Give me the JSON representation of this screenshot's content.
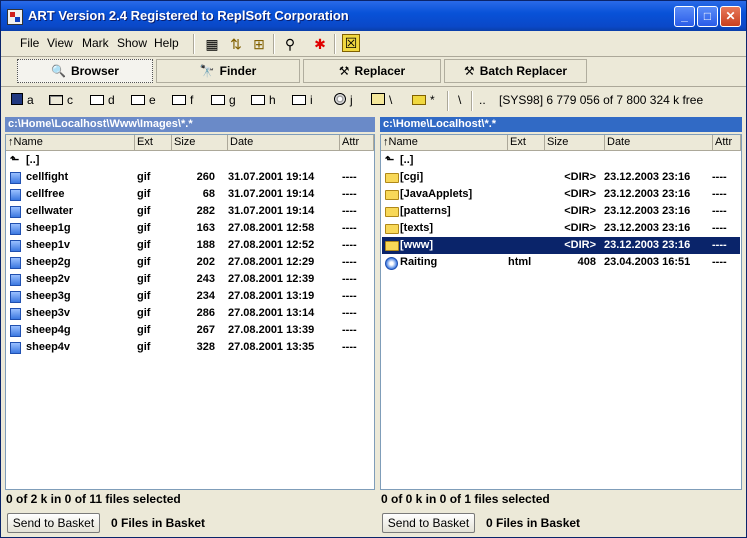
{
  "window": {
    "title": "ART Version 2.4 Registered to ReplSoft Corporation",
    "controls": {
      "minimize": "_",
      "maximize": "□",
      "close": "✕"
    }
  },
  "menu": [
    "File",
    "View",
    "Mark",
    "Show",
    "Help"
  ],
  "toolbar_icons": [
    "grid-icon",
    "sort-icon",
    "tree-icon",
    "search-tool-icon",
    "star-icon",
    "exit-icon"
  ],
  "modes": [
    {
      "label": "Browser",
      "icon": "magnifier-icon",
      "active": true
    },
    {
      "label": "Finder",
      "icon": "binoculars-icon",
      "active": false
    },
    {
      "label": "Replacer",
      "icon": "hammer-icon",
      "active": false
    },
    {
      "label": "Batch Replacer",
      "icon": "hammer-icon",
      "active": false
    }
  ],
  "drives": [
    {
      "letter": "a",
      "type": "floppy"
    },
    {
      "letter": "c",
      "type": "hdd",
      "selected": true
    },
    {
      "letter": "d",
      "type": "hdd"
    },
    {
      "letter": "e",
      "type": "hdd"
    },
    {
      "letter": "f",
      "type": "hdd"
    },
    {
      "letter": "g",
      "type": "hdd"
    },
    {
      "letter": "h",
      "type": "hdd"
    },
    {
      "letter": "i",
      "type": "hdd"
    },
    {
      "letter": "j",
      "type": "cd"
    },
    {
      "letter": "\\",
      "type": "network"
    },
    {
      "letter": "*",
      "type": "favorite"
    },
    {
      "letter": "\\",
      "type": "none"
    },
    {
      "letter": "..",
      "type": "none"
    }
  ],
  "free_space": "[SYS98]  6 779 056 of 7 800 324 k free",
  "left_panel": {
    "path": "c:\\Home\\Localhost\\Www\\Images\\*.*",
    "columns": [
      "↑Name",
      "Ext",
      "Size",
      "Date",
      "Attr"
    ],
    "rows": [
      {
        "name": "[..]",
        "ext": "",
        "size": "",
        "date": "",
        "attr": "",
        "icon": "up"
      },
      {
        "name": "cellfight",
        "ext": "gif",
        "size": "260",
        "date": "31.07.2001 19:14",
        "attr": "----",
        "icon": "file"
      },
      {
        "name": "cellfree",
        "ext": "gif",
        "size": "68",
        "date": "31.07.2001 19:14",
        "attr": "----",
        "icon": "file"
      },
      {
        "name": "cellwater",
        "ext": "gif",
        "size": "282",
        "date": "31.07.2001 19:14",
        "attr": "----",
        "icon": "file"
      },
      {
        "name": "sheep1g",
        "ext": "gif",
        "size": "163",
        "date": "27.08.2001 12:58",
        "attr": "----",
        "icon": "file"
      },
      {
        "name": "sheep1v",
        "ext": "gif",
        "size": "188",
        "date": "27.08.2001 12:52",
        "attr": "----",
        "icon": "file"
      },
      {
        "name": "sheep2g",
        "ext": "gif",
        "size": "202",
        "date": "27.08.2001 12:29",
        "attr": "----",
        "icon": "file"
      },
      {
        "name": "sheep2v",
        "ext": "gif",
        "size": "243",
        "date": "27.08.2001 12:39",
        "attr": "----",
        "icon": "file"
      },
      {
        "name": "sheep3g",
        "ext": "gif",
        "size": "234",
        "date": "27.08.2001 13:19",
        "attr": "----",
        "icon": "file"
      },
      {
        "name": "sheep3v",
        "ext": "gif",
        "size": "286",
        "date": "27.08.2001 13:14",
        "attr": "----",
        "icon": "file"
      },
      {
        "name": "sheep4g",
        "ext": "gif",
        "size": "267",
        "date": "27.08.2001 13:39",
        "attr": "----",
        "icon": "file"
      },
      {
        "name": "sheep4v",
        "ext": "gif",
        "size": "328",
        "date": "27.08.2001 13:35",
        "attr": "----",
        "icon": "file"
      }
    ],
    "status": "0 of 2 k in 0 of 11 files selected",
    "basket_button": "Send to Basket",
    "basket_count": "0 Files in Basket"
  },
  "right_panel": {
    "path": "c:\\Home\\Localhost\\*.*",
    "columns": [
      "↑Name",
      "Ext",
      "Size",
      "Date",
      "Attr"
    ],
    "rows": [
      {
        "name": "[..]",
        "ext": "",
        "size": "",
        "date": "",
        "attr": "",
        "icon": "up"
      },
      {
        "name": "[cgi]",
        "ext": "",
        "size": "<DIR>",
        "date": "23.12.2003 23:16",
        "attr": "----",
        "icon": "folder"
      },
      {
        "name": "[JavaApplets]",
        "ext": "",
        "size": "<DIR>",
        "date": "23.12.2003 23:16",
        "attr": "----",
        "icon": "folder"
      },
      {
        "name": "[patterns]",
        "ext": "",
        "size": "<DIR>",
        "date": "23.12.2003 23:16",
        "attr": "----",
        "icon": "folder"
      },
      {
        "name": "[texts]",
        "ext": "",
        "size": "<DIR>",
        "date": "23.12.2003 23:16",
        "attr": "----",
        "icon": "folder"
      },
      {
        "name": "[www]",
        "ext": "",
        "size": "<DIR>",
        "date": "23.12.2003 23:16",
        "attr": "----",
        "icon": "folder",
        "selected": true
      },
      {
        "name": "Raiting",
        "ext": "html",
        "size": "408",
        "date": "23.04.2003 16:51",
        "attr": "----",
        "icon": "html"
      }
    ],
    "status": "0 of 0 k in 0 of 1 files selected",
    "basket_button": "Send to Basket",
    "basket_count": "0 Files in Basket"
  },
  "colors": {
    "selection": "#0a246a",
    "active_path": "#316ac5",
    "inactive_path": "#6a8ac8",
    "face": "#ece9d8"
  }
}
